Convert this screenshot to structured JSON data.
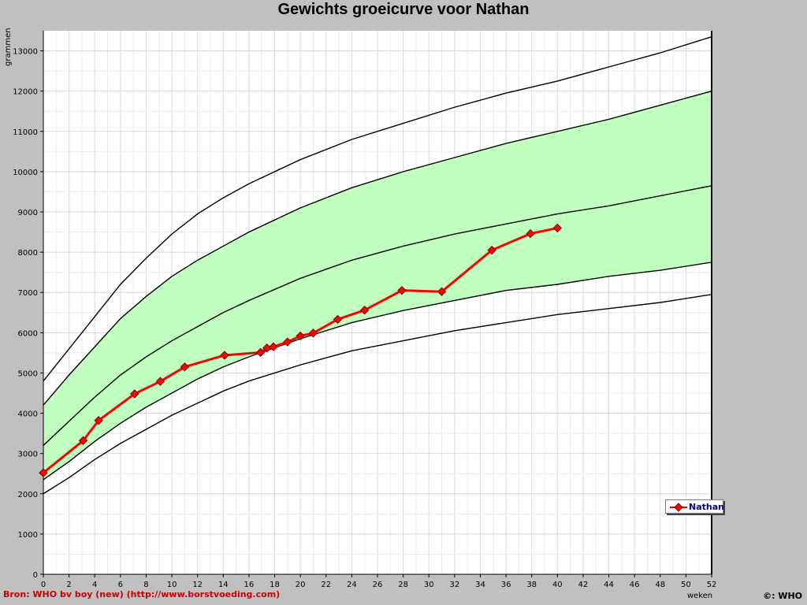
{
  "chart_data": {
    "type": "line",
    "title": "Gewichts groeicurve voor Nathan",
    "xlabel": "weken",
    "ylabel": "grammen",
    "xlim": [
      0,
      52
    ],
    "ylim": [
      0,
      13500
    ],
    "x_ticks": [
      "0",
      "2",
      "4",
      "6",
      "8",
      "10",
      "12",
      "14",
      "16",
      "18",
      "20",
      "22",
      "24",
      "26",
      "28",
      "30",
      "32",
      "34",
      "36",
      "38",
      "40",
      "42",
      "44",
      "46",
      "48",
      "50",
      "52"
    ],
    "y_ticks": [
      "0",
      "1000",
      "2000",
      "3000",
      "4000",
      "5000",
      "6000",
      "7000",
      "8000",
      "9000",
      "10000",
      "11000",
      "12000",
      "13000"
    ],
    "grid": true,
    "legend_position": "bottom-right",
    "reference_weeks": [
      0,
      2,
      4,
      6,
      8,
      10,
      12,
      14,
      16,
      20,
      24,
      28,
      32,
      36,
      40,
      44,
      48,
      52
    ],
    "reference_curves": [
      {
        "values": [
          2000,
          2400,
          2850,
          3250,
          3600,
          3950,
          4250,
          4550,
          4800,
          5200,
          5550,
          5800,
          6050,
          6250,
          6450,
          6600,
          6750,
          6950
        ]
      },
      {
        "values": [
          2350,
          2800,
          3300,
          3750,
          4150,
          4500,
          4850,
          5150,
          5400,
          5850,
          6250,
          6550,
          6800,
          7050,
          7200,
          7400,
          7550,
          7750
        ]
      },
      {
        "values": [
          3200,
          3800,
          4400,
          4950,
          5400,
          5800,
          6150,
          6500,
          6800,
          7350,
          7800,
          8150,
          8450,
          8700,
          8950,
          9150,
          9400,
          9650
        ]
      },
      {
        "values": [
          4200,
          4950,
          5650,
          6350,
          6900,
          7400,
          7800,
          8150,
          8500,
          9100,
          9600,
          10000,
          10350,
          10700,
          11000,
          11300,
          11650,
          12000
        ]
      },
      {
        "values": [
          4800,
          5600,
          6400,
          7200,
          7850,
          8450,
          8950,
          9350,
          9700,
          10300,
          10800,
          11200,
          11600,
          11950,
          12250,
          12600,
          12950,
          13350
        ]
      }
    ],
    "band_color": "#c0ffc0",
    "series": [
      {
        "name": "Nathan",
        "color": "#ff0000",
        "x": [
          0,
          3.1,
          4.3,
          7.1,
          9.1,
          11.0,
          14.1,
          16.9,
          17.4,
          17.9,
          19.0,
          20.0,
          21.0,
          22.9,
          25.0,
          27.9,
          31.0,
          34.9,
          37.9,
          40.0
        ],
        "y": [
          2520,
          3320,
          3820,
          4480,
          4790,
          5150,
          5440,
          5510,
          5620,
          5650,
          5770,
          5920,
          5990,
          6330,
          6560,
          7050,
          7020,
          8050,
          8460,
          8600
        ]
      }
    ]
  },
  "footer": {
    "source": "Bron: WHO bv boy (new) (http://www.borstvoeding.com)",
    "copyright": "©: WHO"
  }
}
